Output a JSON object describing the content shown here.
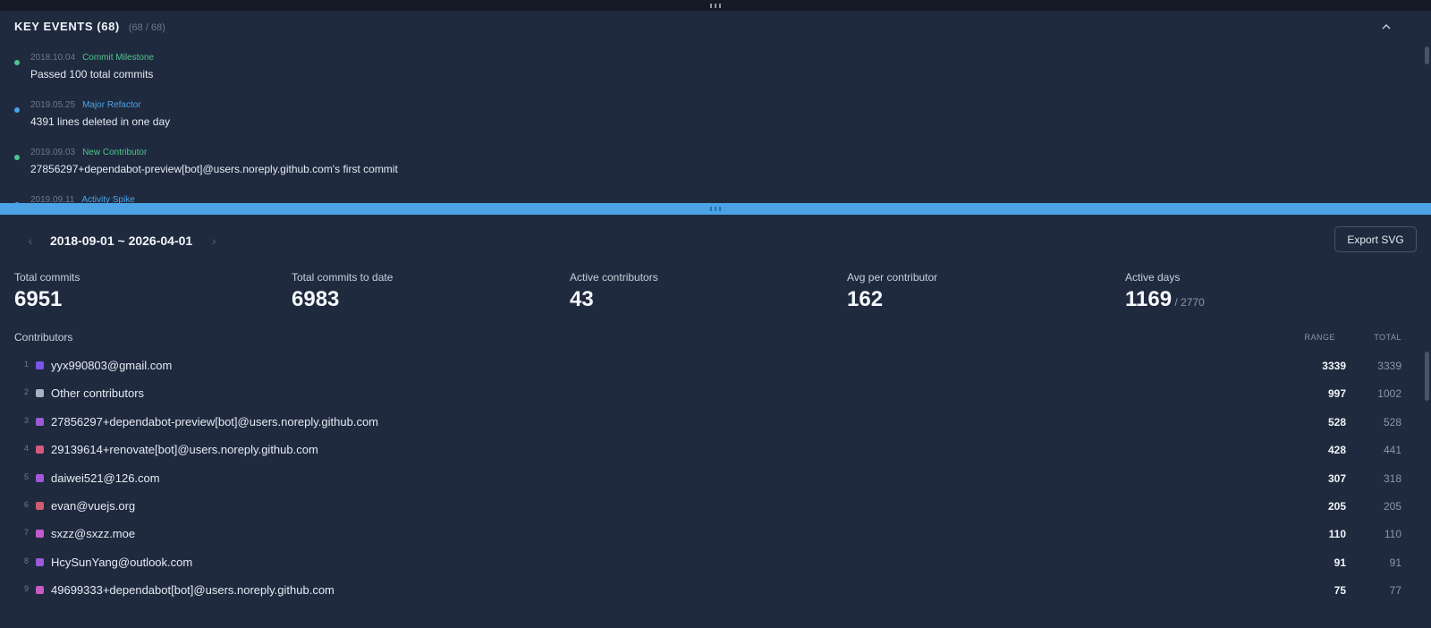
{
  "key_events": {
    "title": "KEY EVENTS (68)",
    "count": "(68 / 68)",
    "collapse_icon": "chevron-up-icon",
    "items": [
      {
        "date": "2018.10.04",
        "type": "Commit Milestone",
        "color": "#4ec58a",
        "type_color": "#4ec58a",
        "desc": "Passed 100 total commits"
      },
      {
        "date": "2019.05.25",
        "type": "Major Refactor",
        "color": "#4ba3e6",
        "type_color": "#4ba3e6",
        "desc": "4391 lines deleted in one day"
      },
      {
        "date": "2019.09.03",
        "type": "New Contributor",
        "color": "#4ec58a",
        "type_color": "#4ec58a",
        "desc": "27856297+dependabot-preview[bot]@users.noreply.github.com's first commit"
      },
      {
        "date": "2019.09.11",
        "type": "Activity Spike",
        "color": "#4ba3e6",
        "type_color": "#4ba3e6",
        "desc": ""
      }
    ]
  },
  "range": {
    "label": "2018-09-01 ~ 2026-04-01",
    "prev_icon": "chevron-left-icon",
    "next_icon": "chevron-right-icon"
  },
  "export_label": "Export SVG",
  "stats": [
    {
      "label": "Total commits",
      "value": "6951",
      "sub": ""
    },
    {
      "label": "Total commits to date",
      "value": "6983",
      "sub": ""
    },
    {
      "label": "Active contributors",
      "value": "43",
      "sub": ""
    },
    {
      "label": "Avg per contributor",
      "value": "162",
      "sub": ""
    },
    {
      "label": "Active days",
      "value": "1169",
      "sub": " / 2770"
    }
  ],
  "contributors": {
    "title": "Contributors",
    "col_range": "RANGE",
    "col_total": "TOTAL",
    "rows": [
      {
        "rank": "1",
        "name": "yyx990803@gmail.com",
        "range": "3339",
        "total": "3339",
        "color": "#7b55e8"
      },
      {
        "rank": "2",
        "name": "Other contributors",
        "range": "997",
        "total": "1002",
        "color": "#a9b1bf"
      },
      {
        "rank": "3",
        "name": "27856297+dependabot-preview[bot]@users.noreply.github.com",
        "range": "528",
        "total": "528",
        "color": "#9b59d6"
      },
      {
        "rank": "4",
        "name": "29139614+renovate[bot]@users.noreply.github.com",
        "range": "428",
        "total": "441",
        "color": "#d45a80"
      },
      {
        "rank": "5",
        "name": "daiwei521@126.com",
        "range": "307",
        "total": "318",
        "color": "#a259d9"
      },
      {
        "rank": "6",
        "name": "evan@vuejs.org",
        "range": "205",
        "total": "205",
        "color": "#d15a6e"
      },
      {
        "rank": "7",
        "name": "sxzz@sxzz.moe",
        "range": "110",
        "total": "110",
        "color": "#c45ad0"
      },
      {
        "rank": "8",
        "name": "HcySunYang@outlook.com",
        "range": "91",
        "total": "91",
        "color": "#9c5ad8"
      },
      {
        "rank": "9",
        "name": "49699333+dependabot[bot]@users.noreply.github.com",
        "range": "75",
        "total": "77",
        "color": "#c85ac4"
      }
    ]
  }
}
